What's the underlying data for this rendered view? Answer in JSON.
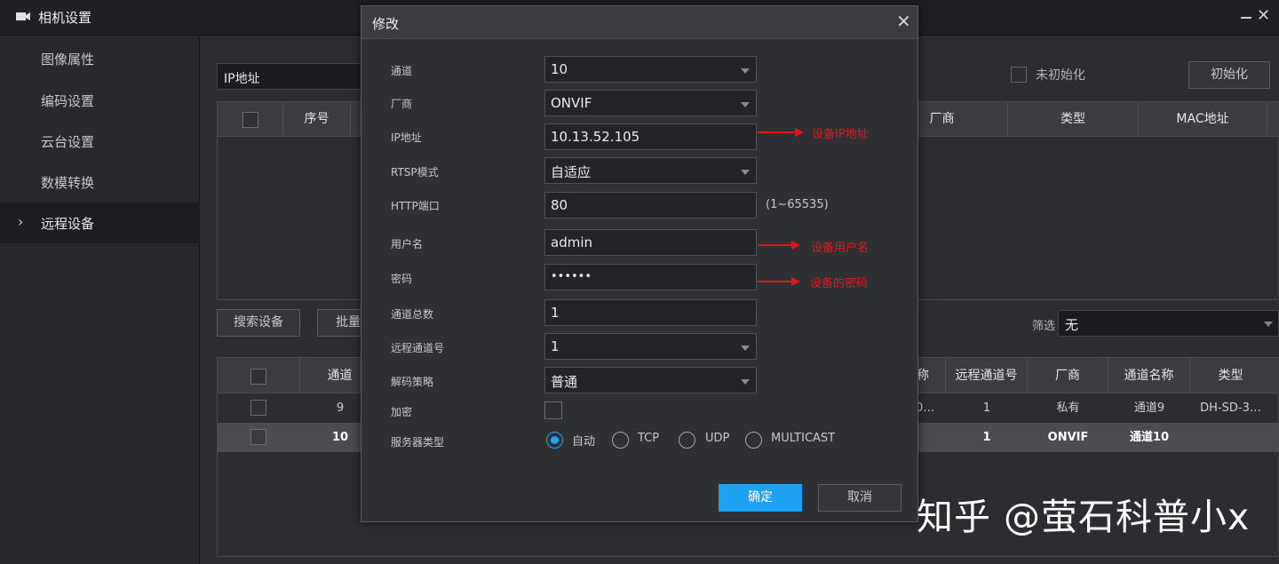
{
  "window": {
    "title": "相机设置",
    "minimize_icon": "minimize-icon",
    "close_label": "✕"
  },
  "sidebar": {
    "items": [
      {
        "label": "图像属性"
      },
      {
        "label": "编码设置"
      },
      {
        "label": "云台设置"
      },
      {
        "label": "数模转换"
      },
      {
        "label": "远程设备",
        "active": true
      }
    ]
  },
  "main": {
    "ip_filter": "IP地址",
    "uninit_label": "未初始化",
    "init_button": "初始化",
    "table1": {
      "headers": [
        "序号",
        "厂商",
        "类型",
        "MAC地址"
      ]
    },
    "search_button": "搜索设备",
    "batch_button": "批量",
    "filter_label": "筛选",
    "filter_value": "无",
    "table2": {
      "headers": [
        "通道",
        "称",
        "远程通道号",
        "厂商",
        "通道名称",
        "类型"
      ],
      "rows": [
        {
          "channel": "9",
          "name_frag": "0…",
          "remote": "1",
          "vendor": "私有",
          "ch_name": "通道9",
          "type": "DH-SD-3…",
          "selected": false
        },
        {
          "channel": "10",
          "name_frag": "",
          "remote": "1",
          "vendor": "ONVIF",
          "ch_name": "通道10",
          "type": "",
          "selected": true
        }
      ]
    }
  },
  "dialog": {
    "title": "修改",
    "close_label": "✕",
    "fields": {
      "channel": {
        "label": "通道",
        "value": "10"
      },
      "vendor": {
        "label": "厂商",
        "value": "ONVIF"
      },
      "ip": {
        "label": "IP地址",
        "value": "10.13.52.105"
      },
      "rtsp": {
        "label": "RTSP模式",
        "value": "自适应"
      },
      "http_port": {
        "label": "HTTP端口",
        "value": "80",
        "hint": "(1~65535)"
      },
      "username": {
        "label": "用户名",
        "value": "admin"
      },
      "password": {
        "label": "密码",
        "value": "••••••"
      },
      "total_channels": {
        "label": "通道总数",
        "value": "1"
      },
      "remote_channel": {
        "label": "远程通道号",
        "value": "1"
      },
      "decode": {
        "label": "解码策略",
        "value": "普通"
      },
      "encrypt": {
        "label": "加密",
        "checked": false
      },
      "server_type": {
        "label": "服务器类型",
        "options": [
          "自动",
          "TCP",
          "UDP",
          "MULTICAST"
        ],
        "selected": "自动"
      }
    },
    "ok_button": "确定",
    "cancel_button": "取消"
  },
  "annotations": {
    "ip": "设备IP地址",
    "username": "设备用户名",
    "password": "设备的密码",
    "color": "#e8141c"
  },
  "watermark": "知乎 @萤石科普小x",
  "colors": {
    "accent": "#1ea1f2",
    "annotation": "#e8141c"
  }
}
